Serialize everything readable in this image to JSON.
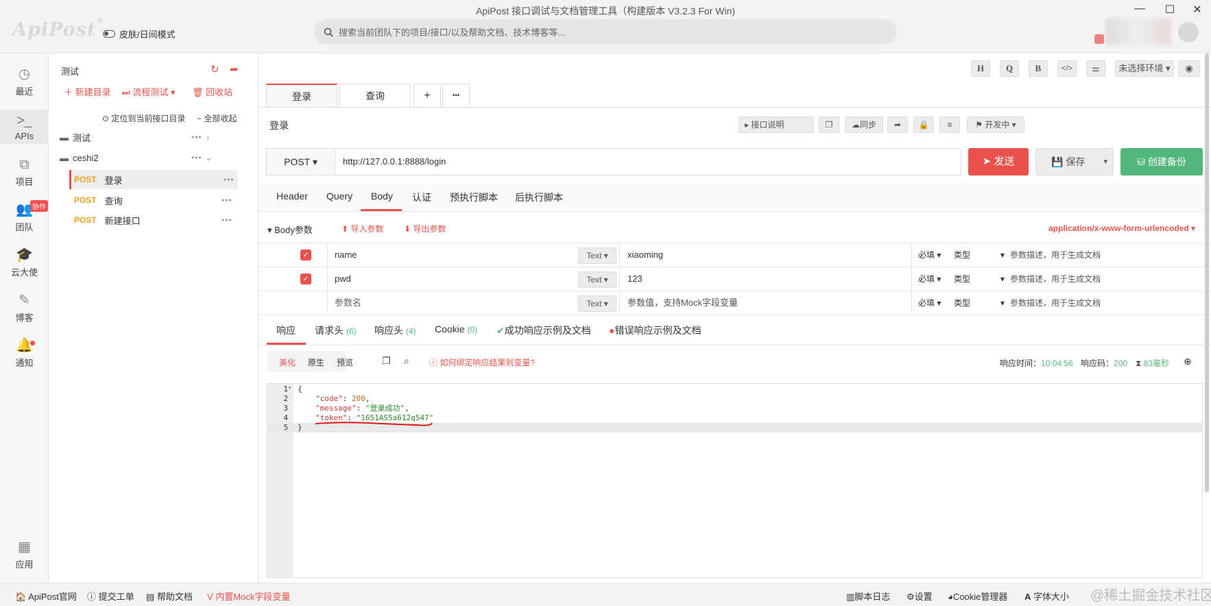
{
  "window": {
    "title": "ApiPost 接口调试与文档管理工具（构建版本 V3.2.3 For Win)",
    "logo": "ApiPost",
    "skin_toggle": "皮肤/日间模式",
    "search_placeholder": "搜索当前团队下的项目/接口/以及帮助文档、技术博客等..."
  },
  "leftnav": {
    "items": [
      {
        "label": "最近",
        "icon": "clock-icon"
      },
      {
        "label": "APIs",
        "icon": "terminal-icon"
      },
      {
        "label": "项目",
        "icon": "project-icon"
      },
      {
        "label": "团队",
        "icon": "team-icon"
      },
      {
        "label": "云大使",
        "icon": "graduation-icon"
      },
      {
        "label": "博客",
        "icon": "edit-icon"
      },
      {
        "label": "通知",
        "icon": "bell-icon"
      },
      {
        "label": "应用",
        "icon": "apps-icon"
      }
    ],
    "collab_badge": "协作"
  },
  "project": {
    "name": "测试",
    "new_folder": "新建目录",
    "flow_test": "流程测试",
    "recycle": "回收站",
    "locate": "定位到当前接口目录",
    "collapse_all": "全部收起",
    "folders": [
      {
        "name": "测试"
      },
      {
        "name": "ceshi2"
      }
    ],
    "apis": [
      {
        "method": "POST",
        "name": "登录"
      },
      {
        "method": "POST",
        "name": "查询"
      },
      {
        "method": "POST",
        "name": "新建接口"
      }
    ]
  },
  "toolbar": {
    "h": "H",
    "q": "Q",
    "b": "B",
    "code": "</>",
    "env": "未选择环境"
  },
  "tabs": [
    {
      "label": "登录"
    },
    {
      "label": "查询"
    },
    {
      "label": "+"
    },
    {
      "label": "•••"
    }
  ],
  "request": {
    "name": "登录",
    "doc_btn": "接口说明",
    "sync_btn": "同步",
    "status_btn": "开发中",
    "method": "POST",
    "url": "http://127.0.0.1:8888/login",
    "send": "发送",
    "save": "保存",
    "backup": "创建备份"
  },
  "req_tabs": [
    "Header",
    "Query",
    "Body",
    "认证",
    "预执行脚本",
    "后执行脚本"
  ],
  "body": {
    "title": "Body参数",
    "import": "导入参数",
    "export": "导出参数",
    "content_type": "application/x-www-form-urlencoded",
    "rows": [
      {
        "checked": true,
        "key": "name",
        "type": "Text",
        "value": "xiaoming",
        "required": "必填",
        "dtype": "类型",
        "desc": "参数描述，用于生成文档"
      },
      {
        "checked": true,
        "key": "pwd",
        "type": "Text",
        "value": "123",
        "required": "必填",
        "dtype": "类型",
        "desc": "参数描述，用于生成文档"
      },
      {
        "checked": false,
        "key": "参数名",
        "type": "Text",
        "value": "参数值，支持Mock字段变量",
        "required": "必填",
        "dtype": "类型",
        "desc": "参数描述，用于生成文档"
      }
    ]
  },
  "response": {
    "tabs": {
      "resp": "响应",
      "req_headers": "请求头",
      "req_headers_count": "(6)",
      "resp_headers": "响应头",
      "resp_headers_count": "(4)",
      "cookie": "Cookie",
      "cookie_count": "(0)",
      "success_doc": "成功响应示例及文档",
      "error_doc": "错误响应示例及文档"
    },
    "view_modes": [
      "美化",
      "原生",
      "预览"
    ],
    "bind_hint": "如何绑定响应结果到变量?",
    "time_label": "响应时间：",
    "time_value": "10:04:56",
    "code_label": "响应码：",
    "code_value": "200",
    "duration": "83毫秒",
    "lines": [
      "1",
      "2",
      "3",
      "4",
      "5"
    ],
    "code": {
      "open": "{",
      "k1": "\"code\"",
      "v1": "200",
      "k2": "\"message\"",
      "v2": "\"登录成功\"",
      "k3": "\"token\"",
      "v3": "\"1651AS5a612q547\"",
      "close": "}"
    }
  },
  "bottombar": {
    "site": "ApiPost官网",
    "ticket": "提交工单",
    "help": "帮助文档",
    "mock": "内置Mock字段变量",
    "script_log": "脚本日志",
    "settings": "设置",
    "cookie_mgr": "Cookie管理器",
    "font_size": "字体大小",
    "watermark": "@稀土掘金技术社区"
  },
  "colors": {
    "accent": "#e8524a",
    "send": "#e8524a",
    "backup": "#52b77b",
    "post": "#f0a020"
  }
}
